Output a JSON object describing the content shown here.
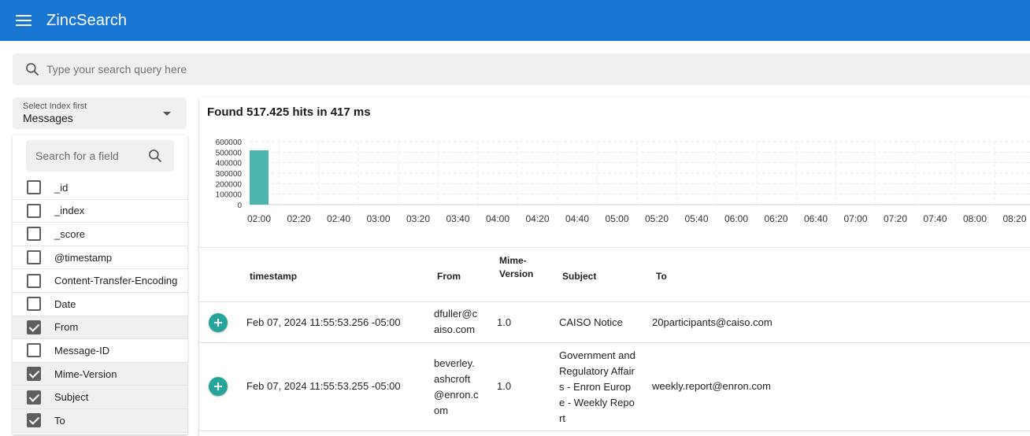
{
  "header": {
    "title": "ZincSearch",
    "menu_icon": "menu-icon"
  },
  "search": {
    "placeholder": "Type your search query here",
    "icon": "search-icon"
  },
  "index_select": {
    "label": "Select Index first",
    "value": "Messages"
  },
  "field_search": {
    "placeholder": "Search for a field"
  },
  "fields": [
    {
      "name": "_id",
      "checked": false
    },
    {
      "name": "_index",
      "checked": false
    },
    {
      "name": "_score",
      "checked": false
    },
    {
      "name": "@timestamp",
      "checked": false
    },
    {
      "name": "Content-Transfer-Encoding",
      "checked": false
    },
    {
      "name": "Date",
      "checked": false
    },
    {
      "name": "From",
      "checked": true
    },
    {
      "name": "Message-ID",
      "checked": false
    },
    {
      "name": "Mime-Version",
      "checked": true
    },
    {
      "name": "Subject",
      "checked": true
    },
    {
      "name": "To",
      "checked": true
    }
  ],
  "hits_text": "Found 517.425 hits in 417 ms",
  "chart_data": {
    "type": "bar",
    "categories": [
      "02:00",
      "02:20",
      "02:40",
      "03:00",
      "03:20",
      "03:40",
      "04:00",
      "04:20",
      "04:40",
      "05:00",
      "05:20",
      "05:40",
      "06:00",
      "06:20",
      "06:40",
      "07:00",
      "07:20",
      "07:40",
      "08:00",
      "08:20"
    ],
    "values": [
      517425,
      0,
      0,
      0,
      0,
      0,
      0,
      0,
      0,
      0,
      0,
      0,
      0,
      0,
      0,
      0,
      0,
      0,
      0,
      0
    ],
    "y_ticks": [
      "600000",
      "500000",
      "400000",
      "300000",
      "200000",
      "100000",
      "0"
    ],
    "ylim": [
      0,
      600000
    ],
    "bar_color": "#4db6ac",
    "grid": true
  },
  "table": {
    "headers": [
      "timestamp",
      "From",
      "Mime-\nVersion",
      "Subject",
      "To"
    ],
    "rows": [
      {
        "timestamp": "Feb 07, 2024 11:55:53.256 -05:00",
        "from": "dfuller@caiso.com",
        "mime": "1.0",
        "subject": "CAISO Notice",
        "to": "20participants@caiso.com"
      },
      {
        "timestamp": "Feb 07, 2024 11:55:53.255 -05:00",
        "from": "beverley.ashcroft@enron.com",
        "mime": "1.0",
        "subject": "Government and Regulatory Affairs - Enron Europe - Weekly Report",
        "to": "weekly.report@enron.com"
      }
    ]
  },
  "colors": {
    "header": "#1976d2",
    "accent": "#26a69a"
  }
}
